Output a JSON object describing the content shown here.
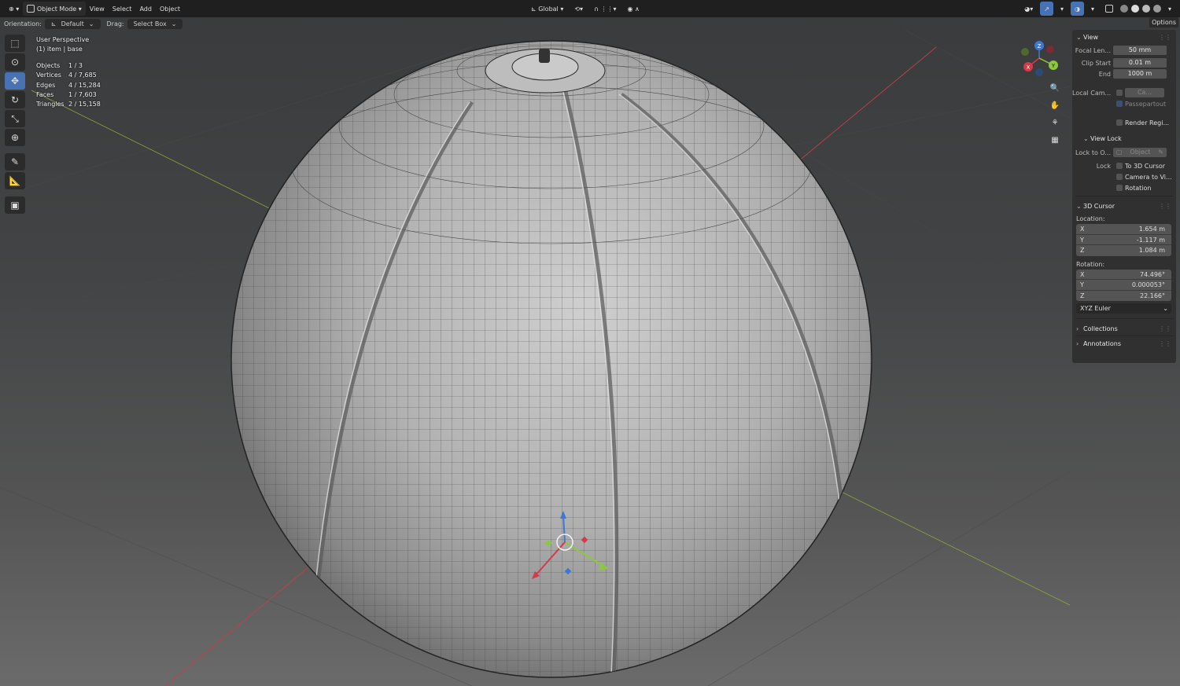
{
  "header": {
    "mode": "Object Mode",
    "menus": [
      "View",
      "Select",
      "Add",
      "Object"
    ],
    "transform_orientation": "Global"
  },
  "subheader": {
    "orientation_label": "Orientation:",
    "orientation_value": "Default",
    "drag_label": "Drag:",
    "drag_value": "Select Box",
    "options_label": "Options"
  },
  "overlay": {
    "view_name": "User Perspective",
    "context": "(1) item | base",
    "stats": [
      {
        "label": "Objects",
        "value": "1 / 3"
      },
      {
        "label": "Vertices",
        "value": "4 / 7,685"
      },
      {
        "label": "Edges",
        "value": "4 / 15,284"
      },
      {
        "label": "Faces",
        "value": "1 / 7,603"
      },
      {
        "label": "Triangles",
        "value": "2 / 15,158"
      }
    ]
  },
  "gizmo": {
    "z": "Z",
    "y": "Y",
    "x": "X"
  },
  "sidebar": {
    "view": {
      "title": "View",
      "focal_label": "Focal Len...",
      "focal_value": "50 mm",
      "clip_start_label": "Clip Start",
      "clip_start_value": "0.01 m",
      "end_label": "End",
      "end_value": "1000 m",
      "local_cam_label": "Local Cam...",
      "local_cam_value": "Ca...",
      "passepartout": "Passepartout",
      "render_region": "Render Regi..."
    },
    "view_lock": {
      "title": "View Lock",
      "lock_to_label": "Lock to O...",
      "lock_to_placeholder": "Object",
      "lock_label": "Lock",
      "to_cursor": "To 3D Cursor",
      "camera_to_view": "Camera to Vi...",
      "rotation": "Rotation"
    },
    "cursor": {
      "title": "3D Cursor",
      "location_label": "Location:",
      "location": [
        {
          "axis": "X",
          "value": "1.654 m"
        },
        {
          "axis": "Y",
          "value": "-1.117 m"
        },
        {
          "axis": "Z",
          "value": "1.084 m"
        }
      ],
      "rotation_label": "Rotation:",
      "rotation": [
        {
          "axis": "X",
          "value": "74.496°"
        },
        {
          "axis": "Y",
          "value": "0.000053°"
        },
        {
          "axis": "Z",
          "value": "22.166°"
        }
      ],
      "rotation_mode": "XYZ Euler"
    },
    "collections": "Collections",
    "annotations": "Annotations"
  },
  "colors": {
    "header_bg": "#1f1f1f",
    "active_tool": "#4772b3",
    "axis_x": "#d33b4b",
    "axis_y": "#8cc83c",
    "axis_z": "#3c78d8"
  }
}
